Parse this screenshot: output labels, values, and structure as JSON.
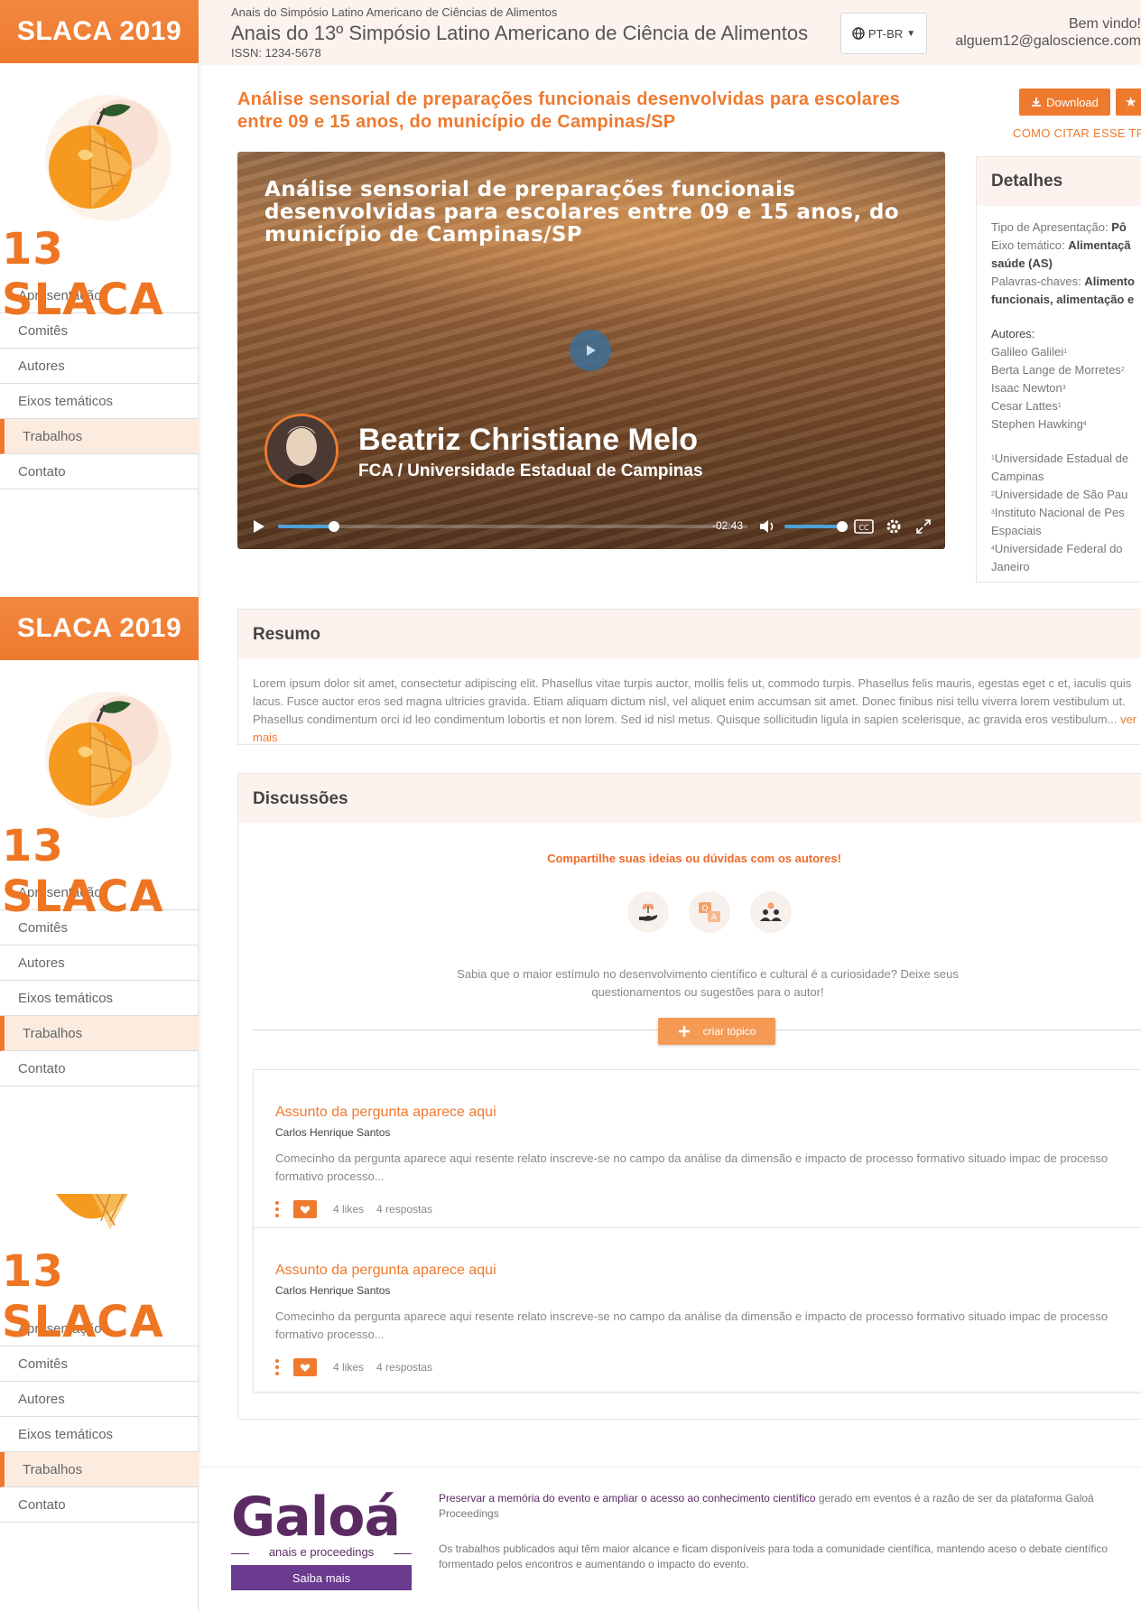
{
  "sidebar": {
    "brand": "SLACA 2019",
    "logo_text": "13 SLACA",
    "items": [
      {
        "label": "Apresentação"
      },
      {
        "label": "Comitês"
      },
      {
        "label": "Autores"
      },
      {
        "label": "Eixos temáticos"
      },
      {
        "label": "Trabalhos",
        "active": true
      },
      {
        "label": "Contato"
      }
    ]
  },
  "header": {
    "supertitle": "Anais do Simpósio Latino Americano de Ciências de Alimentos",
    "title": "Anais do 13º Simpósio Latino Americano de Ciência de Alimentos",
    "issn": "ISSN: 1234-5678",
    "language": "PT-BR",
    "greeting": "Bem vindo!",
    "email": "alguem12@galoscience.com"
  },
  "article": {
    "title": "Análise sensorial de preparações funcionais desenvolvidas para escolares entre 09 e 15 anos, do município de Campinas/SP",
    "download_label": "Download",
    "cite_label": "COMO CITAR ESSE TRA"
  },
  "video": {
    "title": "Análise sensorial de preparações funcionais desenvolvidas para escolares entre 09 e 15 anos, do município de Campinas/SP",
    "speaker": "Beatriz Christiane Melo",
    "affiliation": "FCA / Universidade Estadual de Campinas",
    "time_remaining": "-02:43",
    "progress_percent": 12,
    "volume_percent": 100
  },
  "details": {
    "heading": "Detalhes",
    "type_label": "Tipo de Apresentação:",
    "type_value": "Pô",
    "axis_label": "Eixo temático:",
    "axis_value_1": "Alimentaçã",
    "axis_value_2": "saúde (AS)",
    "keywords_label": "Palavras-chaves:",
    "keywords_value_1": "Alimento",
    "keywords_value_2": "funcionais, alimentação e",
    "authors_label": "Autores:",
    "authors": [
      {
        "name": "Galileo Galilei",
        "sup": "1"
      },
      {
        "name": "Berta Lange de Morretes",
        "sup": "2"
      },
      {
        "name": "Isaac Newton",
        "sup": "3"
      },
      {
        "name": "Cesar Lattes",
        "sup": "1"
      },
      {
        "name": "Stephen Hawking",
        "sup": "4"
      }
    ],
    "institutions": [
      {
        "sup": "1",
        "line1": "Universidade Estadual de",
        "line2": "Campinas"
      },
      {
        "sup": "2",
        "line1": "Universidade de São Pau",
        "line2": ""
      },
      {
        "sup": "3",
        "line1": "Instituto Nacional de Pes",
        "line2": "Espaciais"
      },
      {
        "sup": "4",
        "line1": "Universidade Federal do",
        "line2": "Janeiro"
      }
    ]
  },
  "resumo": {
    "heading": "Resumo",
    "text": "Lorem ipsum dolor sit amet, consectetur adipiscing elit. Phasellus vitae turpis auctor, mollis felis ut, commodo turpis. Phasellus felis mauris, egestas eget c et, iaculis quis lacus. Fusce auctor eros sed magna ultricies gravida. Etiam aliquam dictum nisl, vel aliquet enim accumsan sit amet. Donec finibus nisi tellu viverra lorem vestibulum ut. Phasellus condimentum orci id leo condimentum lobortis et non lorem. Sed id nisl metus. Quisque sollicitudin ligula in sapien scelerisque, ac gravida eros vestibulum...",
    "more": "ver mais"
  },
  "discussions": {
    "heading": "Discussões",
    "share": "Compartilhe suas ideias ou dúvidas com os autores!",
    "subtext": "Sabia que o maior estímulo no desenvolvimento científico e cultural é a curiosidade? Deixe seus questionamentos ou sugestões para o autor!",
    "create_topic": "criar tópico",
    "questions": [
      {
        "title": "Assunto da pergunta aparece aqui",
        "author": "Carlos Henrique Santos",
        "text": "Comecinho da pergunta aparece aqui resente relato inscreve-se no campo da análise da dimensão e impacto de processo formativo situado impac de processo formativo processo...",
        "likes": "4 likes",
        "replies": "4 respostas"
      },
      {
        "title": "Assunto da pergunta aparece aqui",
        "author": "Carlos Henrique Santos",
        "text": "Comecinho da pergunta aparece aqui resente relato inscreve-se no campo da análise da dimensão e impacto de processo formativo situado impac de processo formativo processo...",
        "likes": "4 likes",
        "replies": "4 respostas"
      }
    ]
  },
  "footer": {
    "logo": "Galoá",
    "logo_sub": "anais e proceedings",
    "button": "Saiba mais",
    "p1_bold": "Preservar a memória do evento e ampliar o acesso ao conhecimento científico",
    "p1_rest": " gerado em eventos é a razão de ser da plataforma Galoá Proceedings",
    "p2": "Os trabalhos publicados aqui têm maior alcance e ficam disponíveis para toda a comunidade científica, mantendo aceso o debate científico formentado pelos encontros e aumentando o impacto do evento."
  },
  "colors": {
    "accent": "#ee7a2f",
    "header_bg": "#fcf3ee",
    "brand_purple": "#5b2a63"
  }
}
